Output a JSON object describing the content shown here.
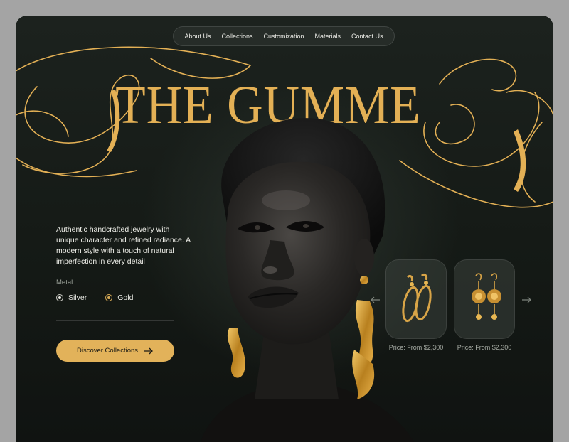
{
  "nav": {
    "items": [
      "About Us",
      "Collections",
      "Customization",
      "Materials",
      "Contact Us"
    ]
  },
  "headline": {
    "text": "THE GUMME"
  },
  "intro": {
    "description": "Authentic handcrafted jewelry with unique character and refined radiance. A modern style with a touch of natural imperfection in every detail"
  },
  "metal": {
    "label": "Metal:",
    "options": [
      "Silver",
      "Gold"
    ]
  },
  "cta": {
    "label": "Discover Collections",
    "icon": "arrow-right-icon"
  },
  "products": [
    {
      "price": "Price: From $2,300",
      "image": "gold-hoop-earrings"
    },
    {
      "price": "Price: From $2,300",
      "image": "gold-drop-earrings"
    }
  ],
  "carousel": {
    "prev_icon": "arrow-left-icon",
    "next_icon": "arrow-right-icon"
  },
  "colors": {
    "accent": "#e2b25a",
    "background": "#161b17",
    "text": "#eeeee8"
  }
}
